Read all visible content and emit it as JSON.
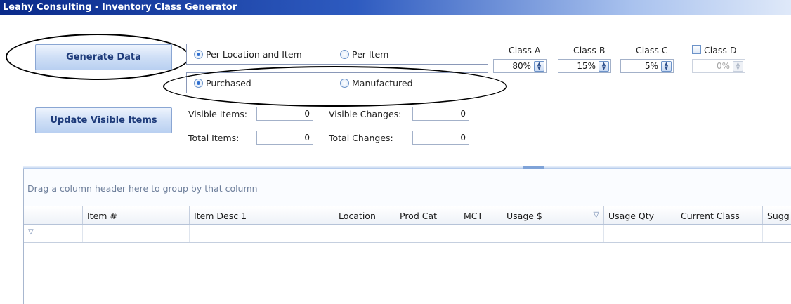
{
  "window": {
    "title": "Leahy Consulting - Inventory Class Generator"
  },
  "buttons": {
    "generate": "Generate Data",
    "update": "Update Visible Items"
  },
  "scope": {
    "per_location": {
      "label": "Per Location and Item",
      "checked": true
    },
    "per_item": {
      "label": "Per Item",
      "checked": false
    }
  },
  "source": {
    "purchased": {
      "label": "Purchased",
      "checked": true
    },
    "manufactured": {
      "label": "Manufactured",
      "checked": false
    }
  },
  "counts": {
    "visible_items_label": "Visible Items:",
    "visible_items": "0",
    "visible_changes_label": "Visible Changes:",
    "visible_changes": "0",
    "total_items_label": "Total Items:",
    "total_items": "0",
    "total_changes_label": "Total Changes:",
    "total_changes": "0"
  },
  "classes": {
    "a": {
      "label": "Class A",
      "value": "80%"
    },
    "b": {
      "label": "Class B",
      "value": "15%"
    },
    "c": {
      "label": "Class C",
      "value": "5%"
    },
    "d": {
      "label": "Class D",
      "value": "0%",
      "enabled": false,
      "checked": false
    }
  },
  "grid": {
    "group_hint": "Drag a column header here to group by that column",
    "columns": [
      "",
      "Item #",
      "Item Desc 1",
      "Location",
      "Prod Cat",
      "MCT",
      "Usage $",
      "Usage Qty",
      "Current Class",
      "Sugg"
    ],
    "filter_icon": "filter-icon",
    "sort_icon": "sort-descending-icon"
  },
  "colors": {
    "title_start": "#0a2a8a",
    "button_text": "#1e3b7a",
    "radio_dot": "#2f6fd0"
  }
}
